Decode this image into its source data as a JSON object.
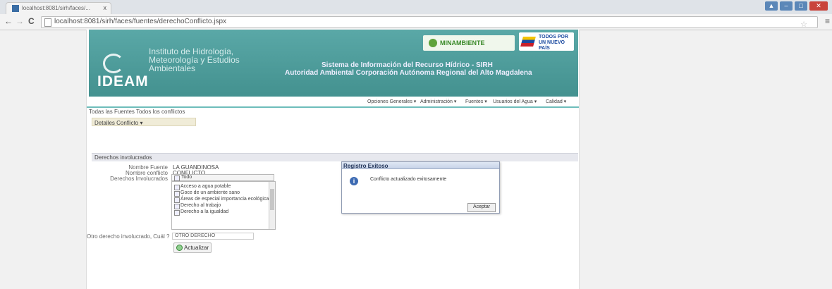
{
  "browser": {
    "tab_title": "localhost:8081/sirh/faces/...",
    "url": "localhost:8081/sirh/faces/fuentes/derechoConflicto.jspx",
    "back": "←",
    "forward": "→",
    "reload": "C",
    "star": "☆",
    "menu": "≡",
    "tab_close": "x"
  },
  "window_controls": {
    "user": "▲",
    "minimize": "–",
    "maximize": "□",
    "close": "✕"
  },
  "banner": {
    "ideam": "IDEAM",
    "institute": "Instituto de Hidrología, Meteorología y Estudios Ambientales",
    "system_line1": "Sistema de Información del Recurso Hídrico - SIRH",
    "system_line2": "Autoridad Ambiental Corporación Autónoma Regional del Alto Magdalena",
    "minambiente": "MINAMBIENTE",
    "todos": "TODOS POR UN NUEVO PAÍS"
  },
  "topnav": [
    "Opciones Generales ▾",
    "Administración ▾",
    "Fuentes ▾",
    "Usuarios del Agua ▾",
    "Calidad ▾"
  ],
  "links": "Todas las Fuentes    Todos los conflictos",
  "detalles_menu": "Detalles Conflicto ▾",
  "section_header": "Derechos involucrados",
  "form": {
    "nombre_fuente_label": "Nombre Fuente",
    "nombre_fuente_value": "LA GUANDINOSA",
    "nombre_conflicto_label": "Nombre conflicto",
    "nombre_conflicto_value": "CONFLICTO",
    "derechos_label": "Derechos Involucrados",
    "todo": "Todo",
    "derechos": [
      "Acceso a agua potable",
      "Goce de un ambiente sano",
      "Áreas de especial importancia ecológica",
      "Derecho al trabajo",
      "Derecho a la igualdad"
    ],
    "otro_label": "Otro derecho involucrado, Cuál ?",
    "otro_value": "OTRO DERECHO",
    "actualizar": "Actualizar"
  },
  "dialog": {
    "title": "Registro Exitoso",
    "message": "Conflicto actualizado exitosamente",
    "ok": "Aceptar"
  }
}
